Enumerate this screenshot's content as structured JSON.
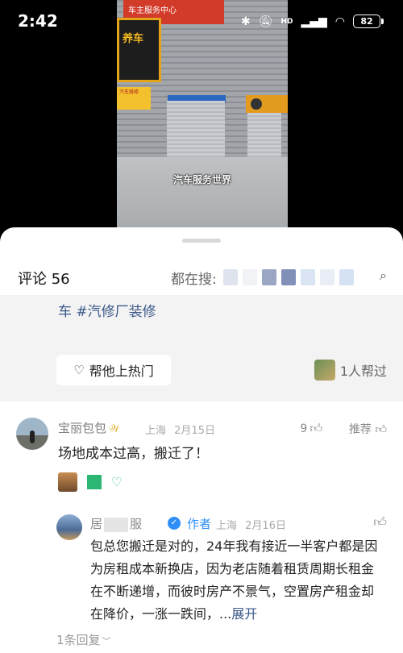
{
  "status": {
    "time": "2:42",
    "icons": [
      "bluetooth-icon",
      "mute-icon",
      "signal-icon",
      "wifi-icon"
    ],
    "hd_label": "HD",
    "battery": "82"
  },
  "video": {
    "caption": "汽车服务世界",
    "top_sign": "车主服务中心",
    "shop_sign": "养车",
    "repair_sign": "汽车维修"
  },
  "sheet": {
    "comment_count_label": "评论 56",
    "search_prefix": "都在搜:",
    "topic_text": "车 #汽修厂装修",
    "help_button_label": "帮他上热门",
    "helped_label": "1人帮过"
  },
  "comment": {
    "username": "宝丽包包",
    "location": "上海",
    "date": "2月15日",
    "likes": "9",
    "recommend_label": "推荐",
    "text": "场地成本过高，搬迁了！"
  },
  "reply": {
    "name_start": "居",
    "name_end": "服",
    "author_tag": "作者",
    "location": "上海",
    "date": "2月16日",
    "text": "包总您搬迁是对的，24年我有接近一半客户都是因为房租成本新换店，因为老店随着租赁周期长租金在不断递增，而彼时房产不景气，空置房产租金却在降价，一涨一跌间，...",
    "expand_label": "展开",
    "more_replies": "1条回复"
  },
  "colors": {
    "link": "#3a5888",
    "verify": "#2f8ef5",
    "vip": "#e2b12f"
  }
}
